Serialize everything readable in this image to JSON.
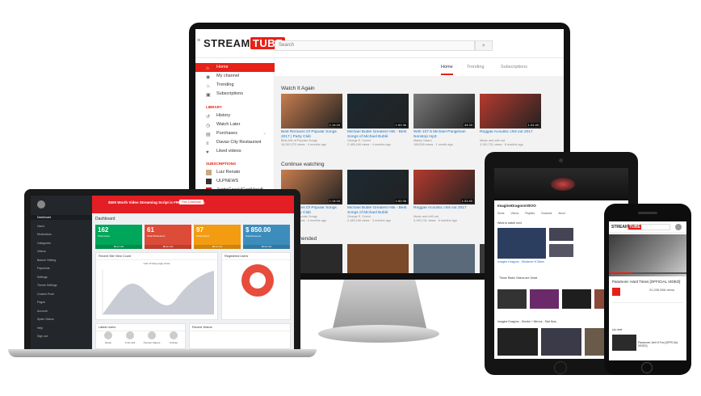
{
  "desktop": {
    "logo_a": "STREAM",
    "logo_b": "TUBE",
    "search_placeholder": "Search",
    "sidebar": [
      {
        "label": "Home",
        "icon": "home-icon"
      },
      {
        "label": "My channel",
        "icon": "channel-icon"
      },
      {
        "label": "Trending",
        "icon": "trending-icon"
      },
      {
        "label": "Subscriptions",
        "icon": "subscriptions-icon"
      }
    ],
    "library_heading": "LIBRARY",
    "library": [
      {
        "label": "History"
      },
      {
        "label": "Watch Later"
      },
      {
        "label": "Purchases"
      },
      {
        "label": "Davao City Restaurant"
      },
      {
        "label": "Liked videos"
      }
    ],
    "subscriptions_heading": "SUBSCRIPTIONS",
    "subscriptions": [
      {
        "label": "Luiz Renato"
      },
      {
        "label": "ULPNEWS"
      },
      {
        "label": "JustinCaseUCantView8"
      }
    ],
    "tabs": [
      "Home",
      "Trending",
      "Subscriptions"
    ],
    "watch_it_again": "Watch It Again",
    "continue_watching": "Continue watching",
    "recommended": "Recommended",
    "videos_row1": [
      {
        "title": "Best Remixes Of Popular Songs 2017 | Party Club",
        "channel": "Best Mix of Popular Songs",
        "views": "16,262,270 views",
        "age": "4 months ago",
        "dur": "1:14:16",
        "color": "#c87d4f"
      },
      {
        "title": "Michael Bublé Greatest Hits - Best Songs of Michael Bublé",
        "channel": "George E. Creed",
        "views": "2,185,166 views",
        "age": "4 months ago",
        "dur": "1:52:36",
        "color": "#1c2a33"
      },
      {
        "title": "With 107.5 Michael Pangilinan Nonstop mp3",
        "channel": "Marky Castro",
        "views": "108,505 views",
        "age": "1 month ago",
        "dur": "34:33",
        "color": "#7a7a7a"
      },
      {
        "title": "Reggae Acoustic chill out 2017",
        "channel": "Music and chill out",
        "views": "3,190,731 views",
        "age": "6 months ago",
        "dur": "1:31:40",
        "color": "#b53a2e"
      }
    ],
    "videos_row2": [
      {
        "title": "Best Remixes Of Popular Songs 2017 | Party Club",
        "channel": "Best Mix of Popular Songs",
        "views": "16,262,270 views",
        "age": "4 months ago",
        "dur": "1:14:16",
        "color": "#c87d4f"
      },
      {
        "title": "Michael Bublé Greatest Hits - Best Songs of Michael Bublé",
        "channel": "George E. Creed",
        "views": "2,185,166 views",
        "age": "4 months ago",
        "dur": "1:52:36",
        "color": "#1c2a33"
      },
      {
        "title": "Reggae Acoustic chill out 2017",
        "channel": "Music and chill out",
        "views": "3,190,731 views",
        "age": "6 months ago",
        "dur": "1:31:40",
        "color": "#b53a2e"
      }
    ]
  },
  "laptop": {
    "banner": "$500 Worth Video Streaming Script is FREE! Start today.",
    "banner_btn": "Free Download",
    "nav": [
      "Dashboard",
      "Users",
      "Moderators",
      "Categories",
      "Videos",
      "Banner Setting",
      "Payments",
      "Settings",
      "Theme Settings",
      "Custom Push",
      "Pages",
      "Account",
      "Spam Videos",
      "Help",
      "Sign out"
    ],
    "dashboard_title": "Dashboard",
    "stats": [
      {
        "num": "162",
        "label": "Total Users",
        "color": "#00a65a"
      },
      {
        "num": "61",
        "label": "Total Moderators",
        "color": "#dd4b39"
      },
      {
        "num": "97",
        "label": "Total Videos",
        "color": "#f39c12"
      },
      {
        "num": "$ 850.00",
        "label": "Total Revenue",
        "color": "#3c8dbc"
      }
    ],
    "more_info": "More info",
    "recent_views_title": "Recent Site View Count",
    "chart_title": "Last 10 days page views",
    "registered_title": "Registered Users",
    "latest_users_title": "Latest Users",
    "latest_users": [
      "ahsan",
      "Kruiz abil",
      "Nomani Papers",
      "Kolinas"
    ],
    "recent_videos_title": "Recent Videos"
  },
  "tablet": {
    "channel": "ImagineDragonsVEVO",
    "tabs": [
      "Home",
      "Videos",
      "Playlists",
      "Channels",
      "About"
    ],
    "what_to_watch": "What to watch next",
    "featured_title": "Imagine Dragons - Whatever It Takes",
    "list_heading": "These Radio Videos are Great",
    "bottom_title": "Imagine Dragons - Smoke + Mirrors - Stat Now"
  },
  "phone": {
    "logo_a": "STREAM",
    "logo_b": "TUBE",
    "search_placeholder": "Search",
    "video_title": "Paramore: Hard Times [OFFICIAL VIDEO]",
    "views": "20,336,856 views",
    "up_next": "Up next",
    "next_title": "Paramore: Ain't It Fun [OFFICIAL VIDEO]"
  }
}
